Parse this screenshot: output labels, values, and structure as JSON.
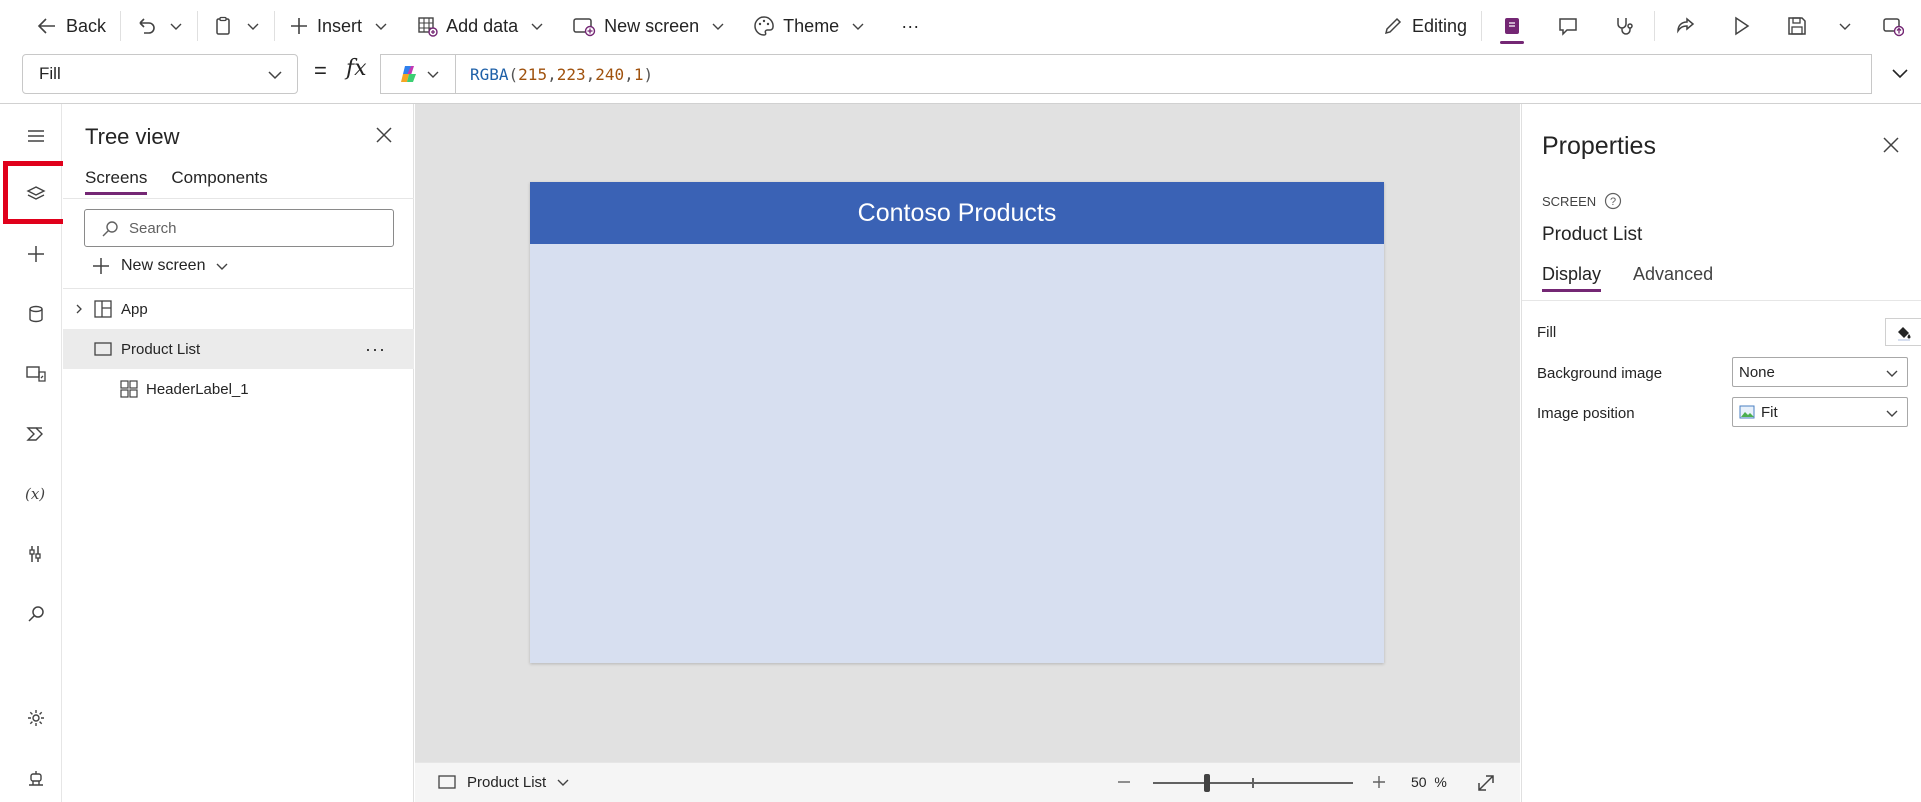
{
  "toolbar": {
    "back_label": "Back",
    "insert_label": "Insert",
    "add_data_label": "Add data",
    "new_screen_label": "New screen",
    "theme_label": "Theme",
    "more_label": "···",
    "editing_label": "Editing"
  },
  "formula_bar": {
    "property": "Fill",
    "equals": "=",
    "fx": "fx",
    "fn_name": "RGBA",
    "args": [
      "215",
      "223",
      "240",
      "1"
    ]
  },
  "tree_view": {
    "title": "Tree view",
    "tabs": [
      "Screens",
      "Components"
    ],
    "search_placeholder": "Search",
    "new_screen_label": "New screen",
    "nodes": [
      {
        "label": "App"
      },
      {
        "label": "Product List"
      },
      {
        "label": "HeaderLabel_1"
      }
    ],
    "more": "···"
  },
  "canvas": {
    "header_text": "Contoso Products",
    "screen_fill": "#d7dff0",
    "header_fill": "#3a62b5"
  },
  "statusbar": {
    "screen_name": "Product List",
    "zoom_value": "50",
    "zoom_unit": "%",
    "zoom_fraction": 0.5
  },
  "properties": {
    "title": "Properties",
    "kind": "SCREEN",
    "name": "Product List",
    "tabs": [
      "Display",
      "Advanced"
    ],
    "rows": {
      "fill_label": "Fill",
      "bg_image_label": "Background image",
      "bg_image_value": "None",
      "image_position_label": "Image position",
      "image_position_value": "Fit"
    }
  },
  "colors": {
    "accent": "#742774",
    "highlight": "#e0001b"
  }
}
